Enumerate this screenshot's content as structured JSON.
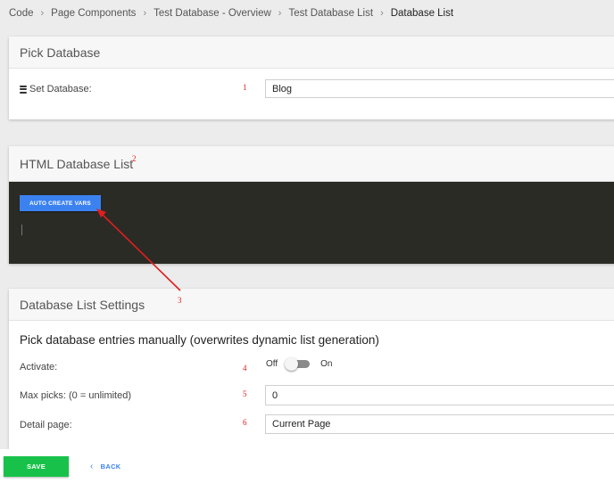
{
  "breadcrumb": {
    "items": [
      "Code",
      "Page Components",
      "Test Database - Overview",
      "Test Database List",
      "Database List"
    ]
  },
  "pick_database": {
    "title": "Pick Database",
    "set_database_label": "Set Database:",
    "set_database_value": "Blog",
    "db_icon": "database-icon"
  },
  "html_list": {
    "title": "HTML Database List",
    "auto_button_label": "AUTO CREATE VARS"
  },
  "settings": {
    "title": "Database List Settings",
    "section_title": "Pick database entries manually (overwrites dynamic list generation)",
    "activate_label": "Activate:",
    "toggle_off_label": "Off",
    "toggle_on_label": "On",
    "toggle_state": "off",
    "max_picks_label": "Max picks: (0 = unlimited)",
    "max_picks_value": "0",
    "detail_page_label": "Detail page:",
    "detail_page_value": "Current Page"
  },
  "annotations": [
    "1",
    "2",
    "3",
    "4",
    "5",
    "6"
  ],
  "footer": {
    "save_label": "SAVE",
    "back_label": "BACK",
    "back_icon": "chevron-left-icon"
  },
  "colors": {
    "background": "#ececec",
    "accent_blue": "#3b82f0",
    "save_green": "#18c24a",
    "editor_dark": "#2b2b26",
    "annotation_red": "#e01e1e"
  }
}
